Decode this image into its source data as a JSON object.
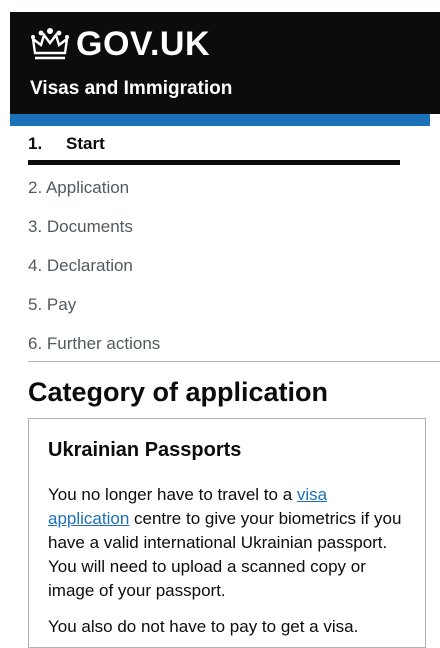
{
  "header": {
    "logo_text": "GOV.UK",
    "crown_icon": "crown-icon",
    "service_name": "Visas and Immigration",
    "colors": {
      "background": "#0b0c0c",
      "accent_bar": "#1d70b8"
    }
  },
  "steps": {
    "active": {
      "number": "1.",
      "label": "Start"
    },
    "items": [
      "2. Application",
      "3. Documents",
      "4. Declaration",
      "5. Pay",
      "6. Further actions"
    ]
  },
  "page_title": "Category of application",
  "panel": {
    "title": "Ukrainian Passports",
    "p1_before": "You no longer have to travel to a ",
    "p1_link": "visa application",
    "p1_after": " centre to give your biometrics if you have a valid international Ukrainian passport. You will need to upload a scanned copy or image of your passport.",
    "p2": "You also do not have to pay to get a visa."
  }
}
